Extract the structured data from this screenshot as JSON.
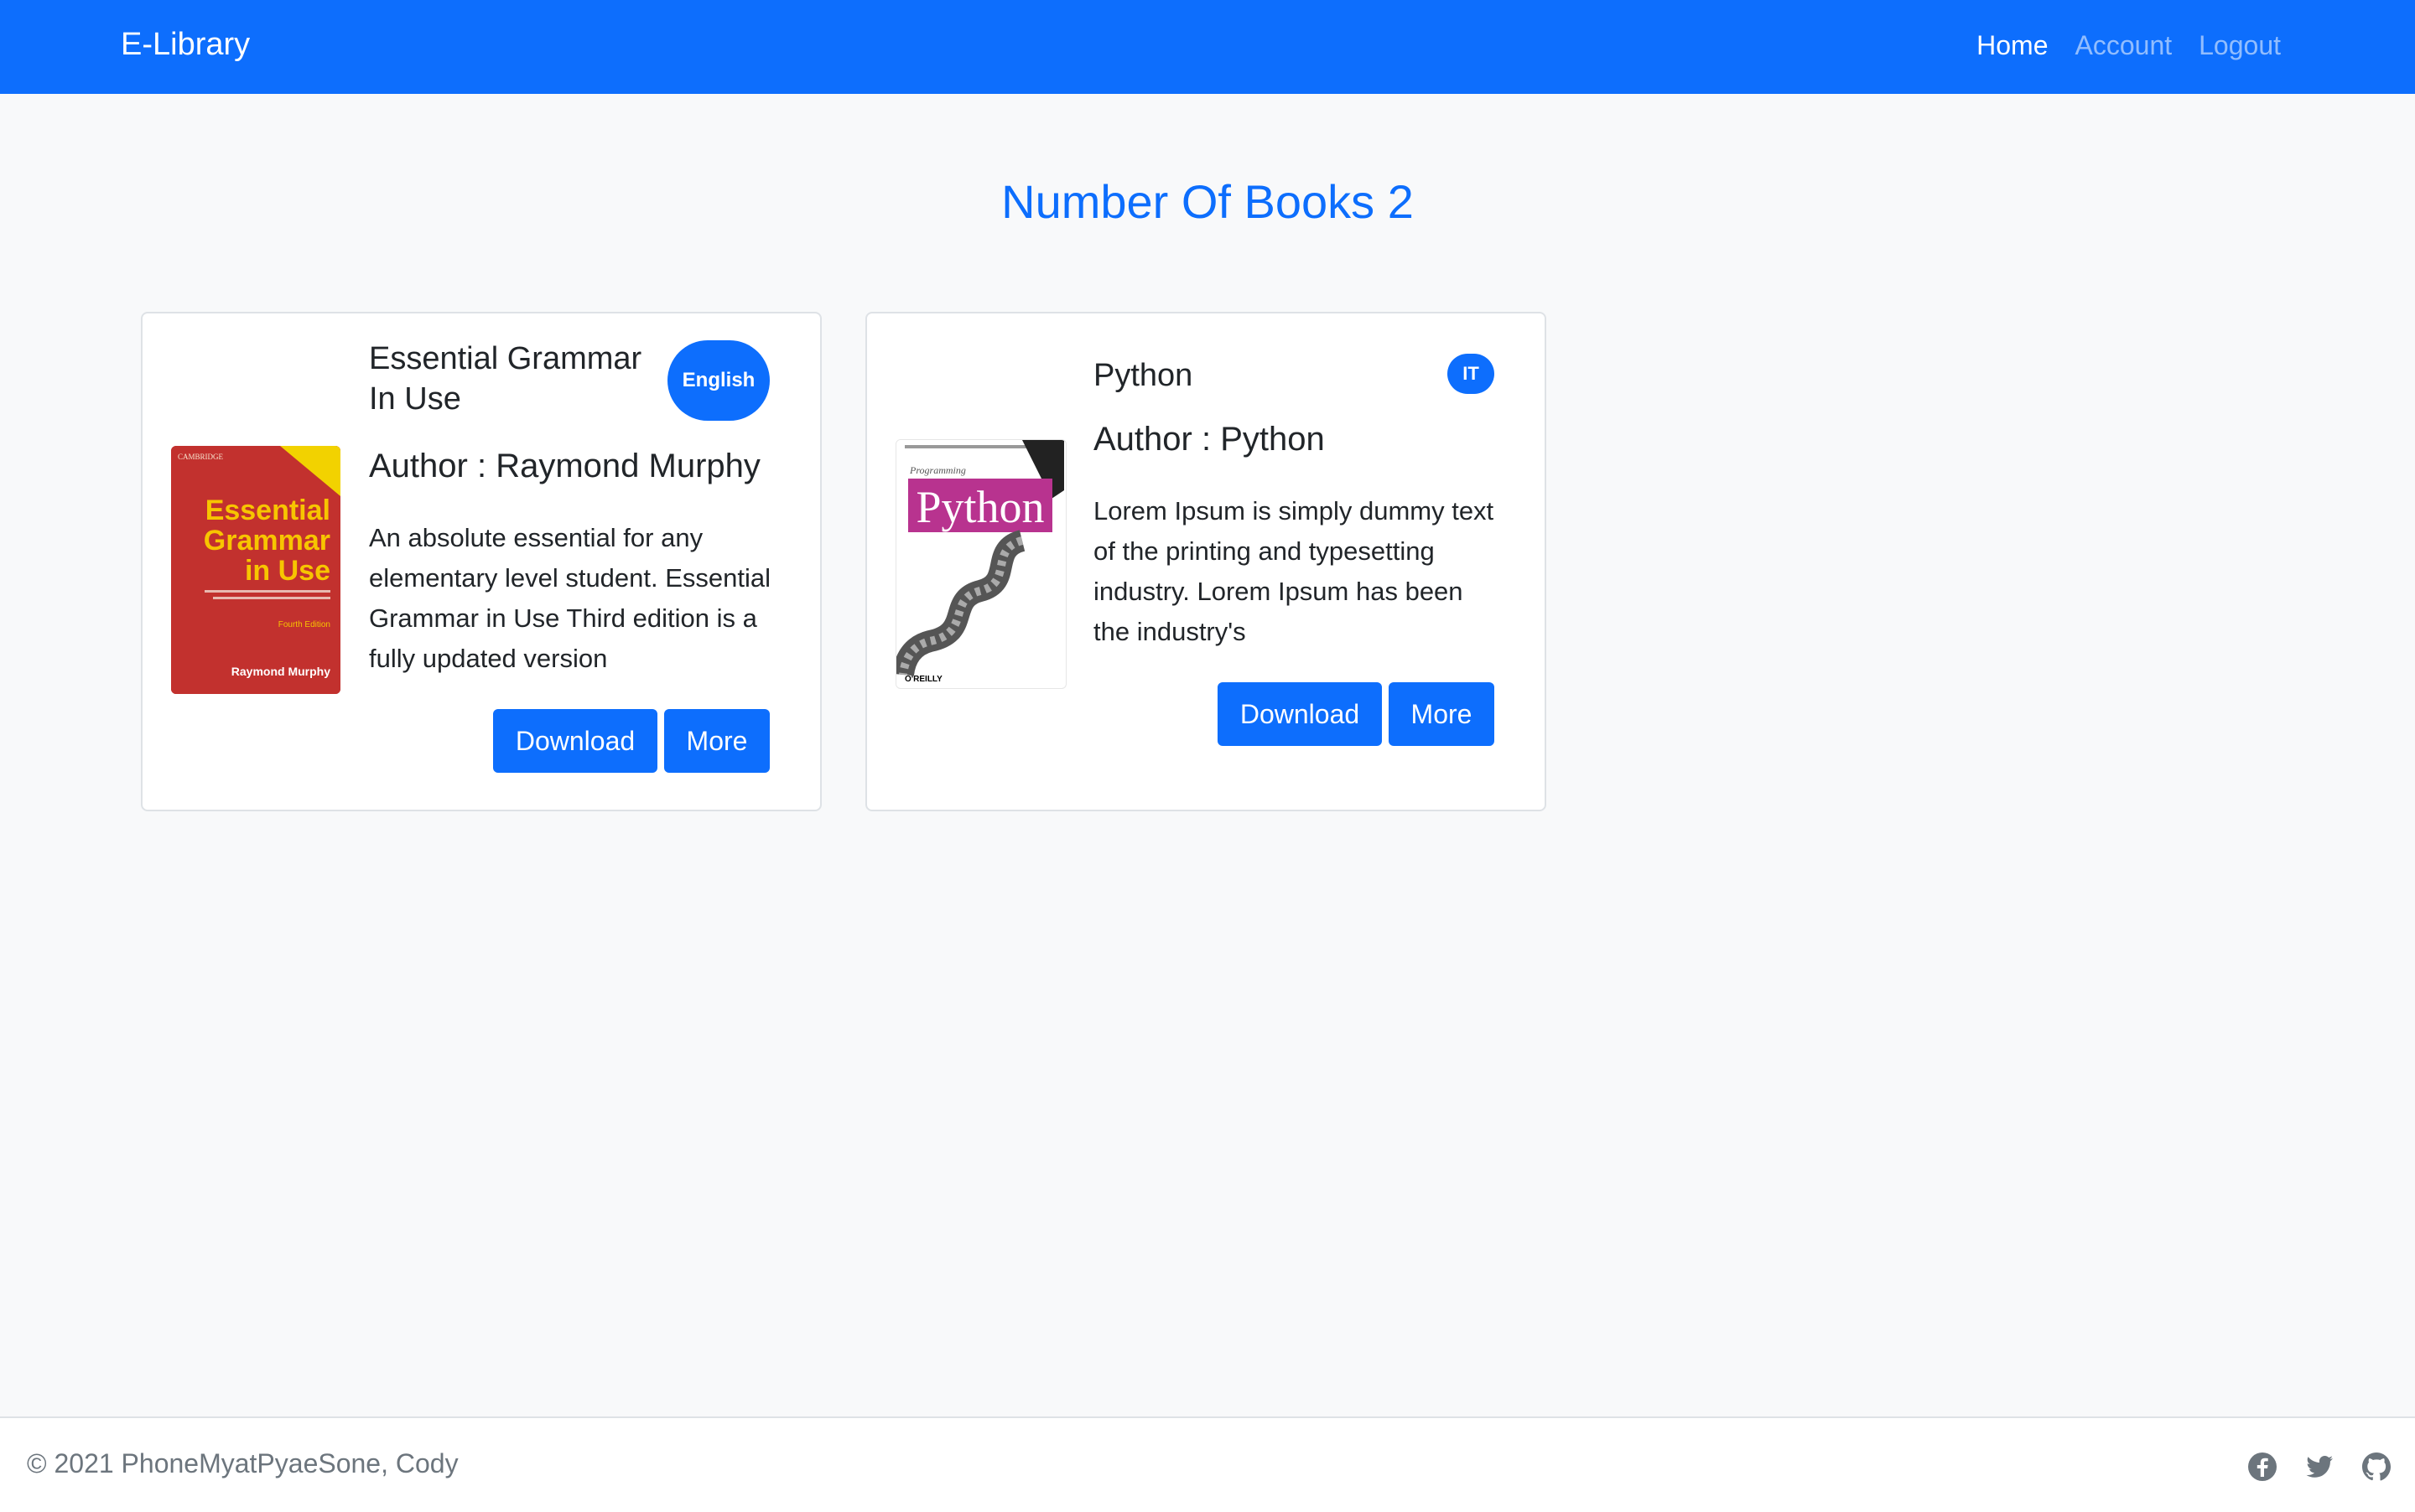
{
  "header": {
    "brand": "E-Library",
    "nav": [
      {
        "label": "Home"
      },
      {
        "label": "Account"
      },
      {
        "label": "Logout"
      }
    ],
    "accent_color": "#0d6efd"
  },
  "main": {
    "title": "Number Of Books 2",
    "books": [
      {
        "title": "Essential Grammar In Use",
        "badge": "English",
        "author": "Author : Raymond Murphy",
        "description": "An absolute essential for any elementary level student. Essential Grammar in Use Third edition is a fully updated version",
        "download_label": "Download",
        "more_label": "More",
        "cover": {
          "publisher": "CAMBRIDGE",
          "title_line1": "Essential",
          "title_line2": "Grammar",
          "title_line3": "in Use",
          "edition": "Fourth Edition",
          "author": "Raymond Murphy"
        }
      },
      {
        "title": "Python",
        "badge": "IT",
        "author": "Author : Python",
        "description": "Lorem Ipsum is simply dummy text of the printing and typesetting industry. Lorem Ipsum has been the industry's",
        "download_label": "Download",
        "more_label": "More",
        "cover": {
          "small": "Programming",
          "title": "Python",
          "publisher": "O'REILLY"
        }
      }
    ]
  },
  "footer": {
    "copyright": "© 2021 PhoneMyatPyaeSone, Cody",
    "social_icons": [
      "facebook-icon",
      "twitter-icon",
      "github-icon"
    ]
  }
}
